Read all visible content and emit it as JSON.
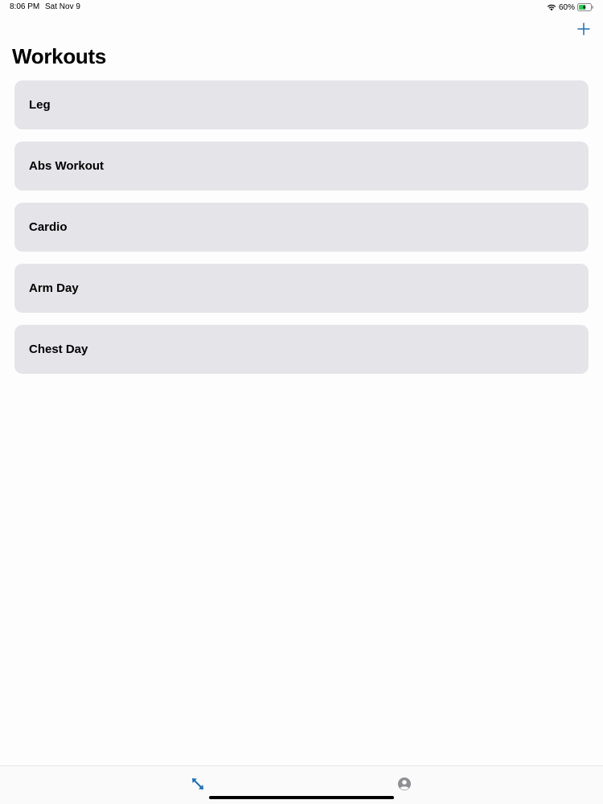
{
  "status_bar": {
    "time": "8:06 PM",
    "date": "Sat Nov 9",
    "battery_percent": "60%",
    "battery_level": 0.6,
    "icons": {
      "wifi": "wifi-icon",
      "battery": "battery-icon"
    }
  },
  "nav": {
    "title": "Workouts",
    "add_icon": "plus-icon"
  },
  "workouts": [
    {
      "label": "Leg"
    },
    {
      "label": "Abs Workout"
    },
    {
      "label": "Cardio"
    },
    {
      "label": "Arm Day"
    },
    {
      "label": "Chest Day"
    }
  ],
  "tab_bar": {
    "tabs": [
      {
        "icon": "expand-arrows-icon",
        "selected": true
      },
      {
        "icon": "person-circle-icon",
        "selected": false
      }
    ]
  },
  "colors": {
    "accent": "#1f6fb2",
    "card_background": "#e5e4e8",
    "inactive_tab": "#8e8e93",
    "page_background": "#fefdfe"
  }
}
